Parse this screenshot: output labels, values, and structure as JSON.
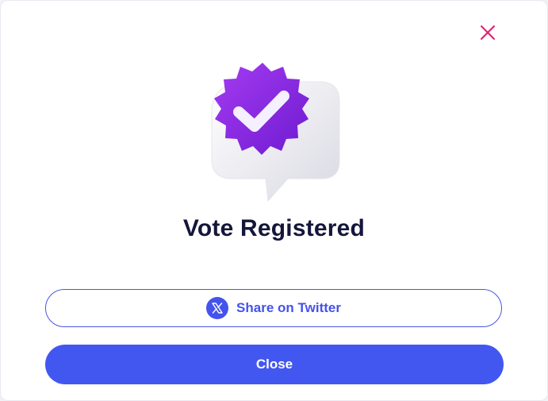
{
  "modal": {
    "title": "Vote Registered",
    "share_button_label": "Share on Twitter",
    "close_button_label": "Close",
    "icons": {
      "close": "close-icon",
      "badge": "verified-badge-icon",
      "twitter": "x-twitter-icon"
    },
    "colors": {
      "accent": "#4257f0",
      "close_x": "#e0206a",
      "badge": "#8a2be2",
      "title": "#15163a"
    }
  }
}
